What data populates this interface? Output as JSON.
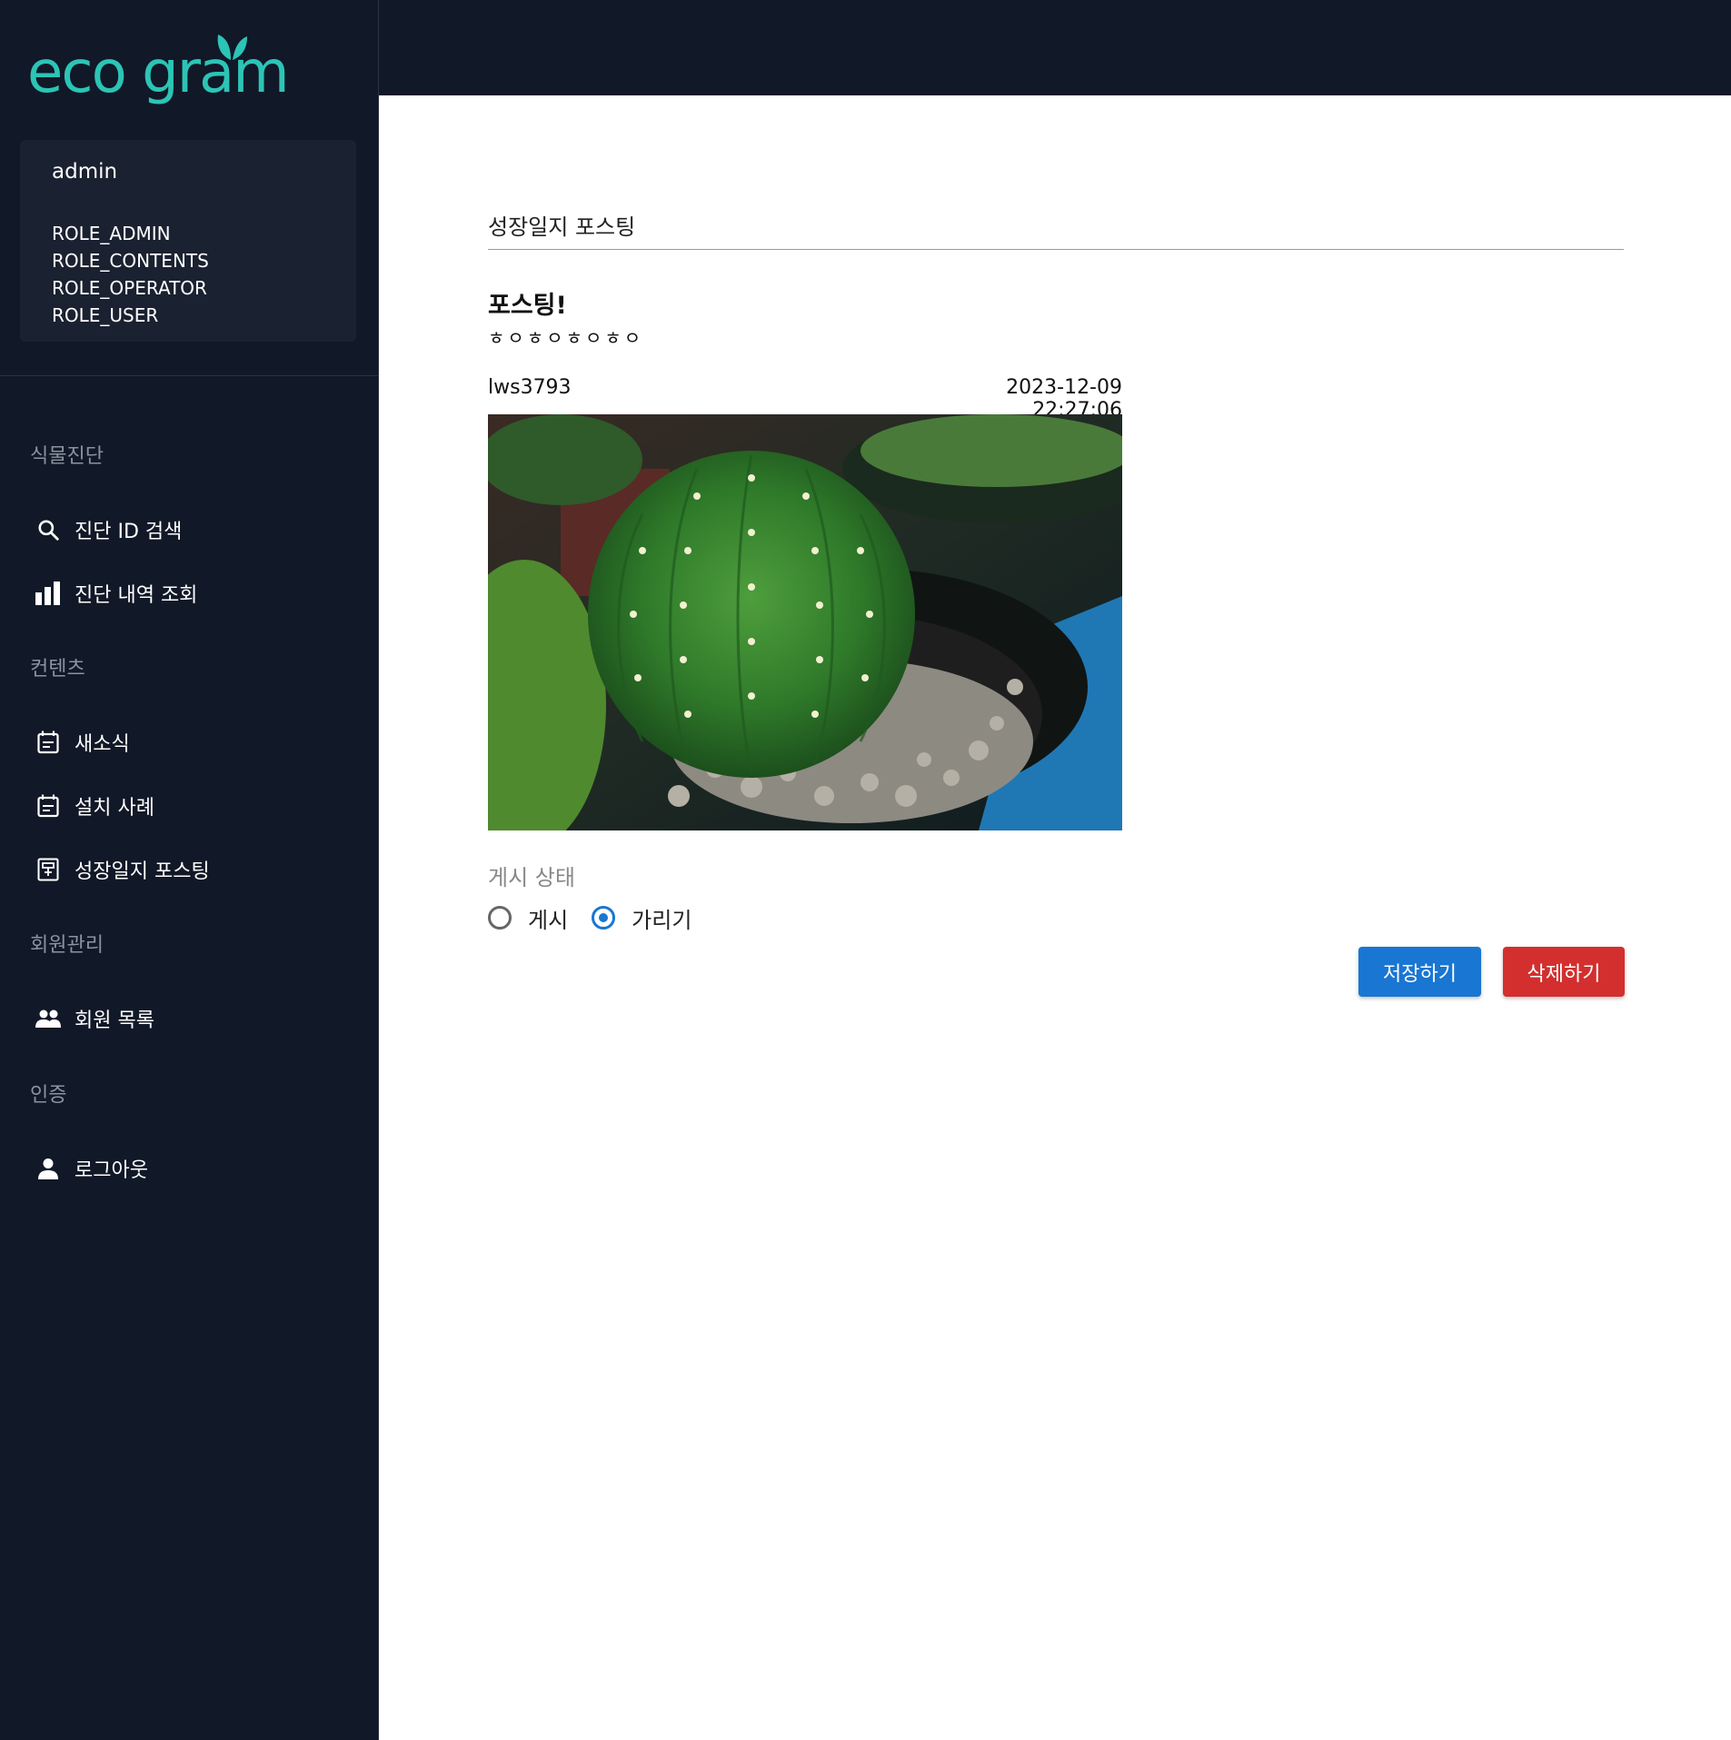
{
  "brand": {
    "logo_text": "eco gram",
    "accent_color": "#2cc4b5"
  },
  "user": {
    "name": "admin",
    "roles": [
      "ROLE_ADMIN",
      "ROLE_CONTENTS",
      "ROLE_OPERATOR",
      "ROLE_USER"
    ]
  },
  "sidebar": {
    "sections": [
      {
        "label": "식물진단",
        "items": [
          {
            "label": "진단 ID 검색",
            "icon": "search-icon"
          },
          {
            "label": "진단 내역 조회",
            "icon": "bar-chart-icon"
          }
        ]
      },
      {
        "label": "컨텐츠",
        "items": [
          {
            "label": "새소식",
            "icon": "calendar-icon"
          },
          {
            "label": "설치 사례",
            "icon": "calendar-icon"
          },
          {
            "label": "성장일지 포스팅",
            "icon": "receipt-icon"
          }
        ]
      },
      {
        "label": "회원관리",
        "items": [
          {
            "label": "회원 목록",
            "icon": "people-icon"
          }
        ]
      },
      {
        "label": "인증",
        "items": [
          {
            "label": "로그아웃",
            "icon": "person-icon"
          }
        ]
      }
    ]
  },
  "page": {
    "title": "성장일지 포스팅",
    "post": {
      "title": "포스팅!",
      "body": "ㅎㅇㅎㅇㅎㅇㅎㅇ",
      "author": "lws3793",
      "date": "2023-12-09 22:27:06",
      "image_subject": "cactus-photo"
    },
    "status": {
      "label": "게시 상태",
      "options": [
        "게시",
        "가리기"
      ],
      "selected": "가리기"
    },
    "buttons": {
      "save": "저장하기",
      "delete": "삭제하기"
    }
  },
  "colors": {
    "sidebar_bg": "#111827",
    "primary": "#1976d2",
    "danger": "#d32f2f"
  }
}
